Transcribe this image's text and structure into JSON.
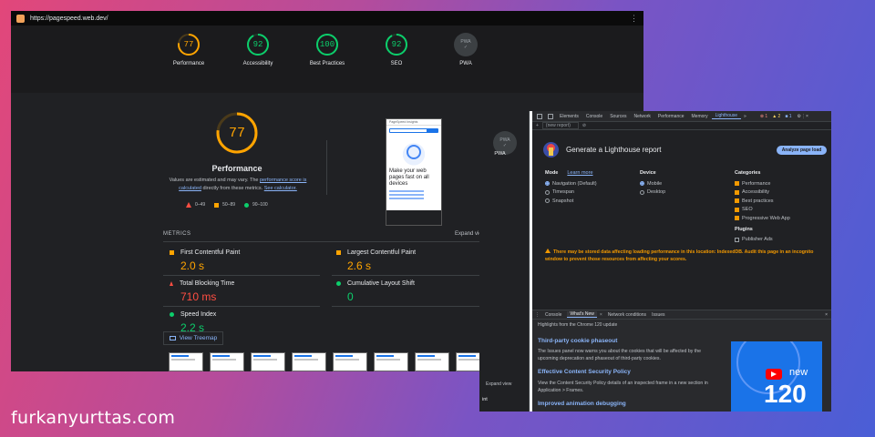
{
  "browser": {
    "url": "https://pagespeed.web.dev/"
  },
  "categories": [
    {
      "label": "Performance",
      "score": "77",
      "color": "#ffa400",
      "fraction": 0.77
    },
    {
      "label": "Accessibility",
      "score": "92",
      "color": "#0cce6b",
      "fraction": 0.92
    },
    {
      "label": "Best Practices",
      "score": "100",
      "color": "#0cce6b",
      "fraction": 1.0
    },
    {
      "label": "SEO",
      "score": "92",
      "color": "#0cce6b",
      "fraction": 0.92
    }
  ],
  "pwa": {
    "badge": "PWA",
    "label": "PWA"
  },
  "performance": {
    "score": "77",
    "fraction": 0.77,
    "title": "Performance",
    "desc_1": "Values are estimated and may vary. The ",
    "desc_link_1": "performance score is calculated",
    "desc_2": " directly from these metrics. ",
    "desc_link_2": "See calculator."
  },
  "legend": {
    "fail": "0–49",
    "average": "50–89",
    "pass": "90–100"
  },
  "preview": {
    "header": "PageSpeed Insights",
    "headline": "Make your web pages fast on all devices"
  },
  "metrics": {
    "title": "METRICS",
    "expand": "Expand view",
    "items": [
      {
        "label": "First Contentful Paint",
        "value": "2.0 s",
        "color": "#ffa400"
      },
      {
        "label": "Largest Contentful Paint",
        "value": "2.6 s",
        "color": "#ffa400"
      },
      {
        "label": "Total Blocking Time",
        "value": "710 ms",
        "color": "#ff4e42"
      },
      {
        "label": "Cumulative Layout Shift",
        "value": "0",
        "color": "#0cce6b"
      },
      {
        "label": "Speed Index",
        "value": "2.2 s",
        "color": "#0cce6b"
      }
    ]
  },
  "treemap": {
    "label": "View Treemap"
  },
  "devtools": {
    "side_pwa": "PWA",
    "side_expand": "Expand view",
    "side_int": "int",
    "tabs": [
      "Elements",
      "Console",
      "Sources",
      "Network",
      "Performance",
      "Memory",
      "Lighthouse"
    ],
    "more_tabs": "»",
    "errors": "1",
    "warnings": "2",
    "infos": "1",
    "new_report": "(new report)",
    "title": "Generate a Lighthouse report",
    "analyze": "Analyze page load",
    "mode": {
      "heading": "Mode",
      "learn_more": "Learn more",
      "options": [
        "Navigation (Default)",
        "Timespan",
        "Snapshot"
      ]
    },
    "device": {
      "heading": "Device",
      "options": [
        "Mobile",
        "Desktop"
      ]
    },
    "categories": {
      "heading": "Categories",
      "options": [
        "Performance",
        "Accessibility",
        "Best practices",
        "SEO",
        "Progressive Web App"
      ]
    },
    "plugins": {
      "heading": "Plugins",
      "options": [
        "Publisher Ads"
      ]
    },
    "warning": "There may be stored data affecting loading performance in this location: IndexedDB. Audit this page in an incognito window to prevent those resources from affecting your scores.",
    "drawer": {
      "tabs": [
        "Console",
        "What's New",
        "Network conditions",
        "Issues"
      ],
      "close_x": "×",
      "subtitle": "Highlights from the Chrome 120 update",
      "news": [
        {
          "heading": "Third-party cookie phaseout",
          "text": "The Issues panel now warns you about the cookies that will be affected by the upcoming deprecation and phaseout of third-party cookies."
        },
        {
          "heading": "Effective Content Security Policy",
          "text": "View the Content Security Policy details of an inspected frame in a new section in Application > Frames."
        },
        {
          "heading": "Improved animation debugging",
          "text": ""
        }
      ],
      "promo_new": "new",
      "promo_version": "120"
    }
  },
  "watermark": "furkanyurttas.com",
  "icons": {
    "kebab": "⋮",
    "close": "×"
  }
}
